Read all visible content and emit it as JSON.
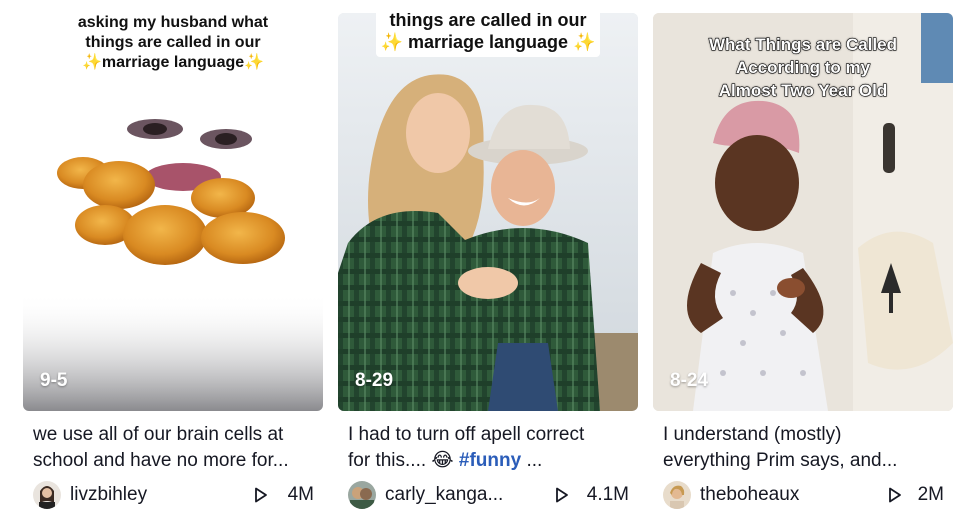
{
  "videos": [
    {
      "overlay_text": [
        "asking my husband what",
        "things are called in our",
        "✨marriage language✨"
      ],
      "date": "9-5",
      "description_line1": "we use all of our brain cells at",
      "description_line2": "school and have no more for...",
      "username": "livzbihley",
      "views": "4M"
    },
    {
      "overlay_text": [
        "things are called in our",
        "✨ marriage language ✨"
      ],
      "date": "8-29",
      "description_line1": "I had to turn off apell correct",
      "description_prefix": "for this....",
      "description_emoji": "😂",
      "description_hashtag": "#funny",
      "description_suffix": "...",
      "username": "carly_kanga...",
      "views": "4.1M"
    },
    {
      "overlay_text": [
        "What Things are Called",
        "According to my",
        "Almost Two Year Old"
      ],
      "date": "8-24",
      "description_line1": "I understand (mostly)",
      "description_line2": "everything Prim says, and...",
      "username": "theboheaux",
      "views": "2M"
    }
  ],
  "icons": {
    "views": "play-icon"
  },
  "colors": {
    "hashtag": "#2b5db9",
    "text": "#161823"
  }
}
